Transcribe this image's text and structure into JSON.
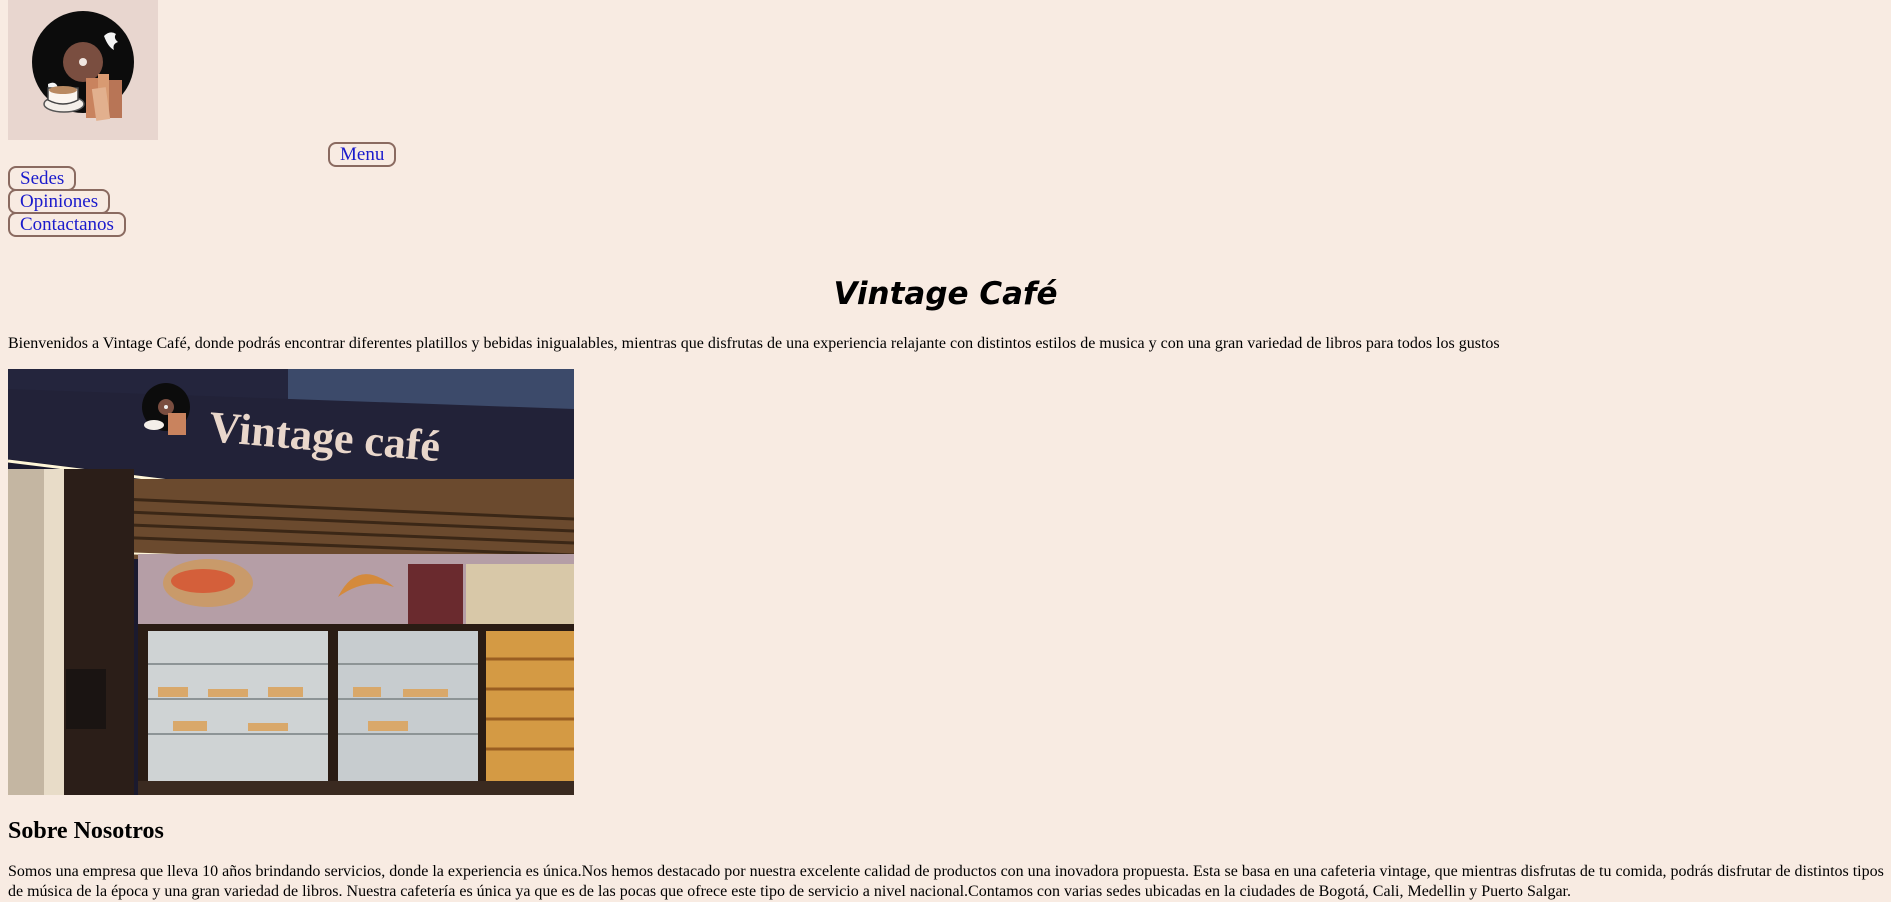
{
  "brand": {
    "logo_icon": "vinyl-coffee-books-logo"
  },
  "nav": {
    "menu": "Menu",
    "sedes": "Sedes",
    "opiniones": "Opiniones",
    "contactanos": "Contactanos"
  },
  "hero": {
    "title": "Vintage Café",
    "intro": "Bienvenidos a Vintage Café, donde podrás encontrar diferentes platillos y bebidas inigualables, mientras que disfrutas de una experiencia relajante con distintos estilos de musica y con una gran variedad de libros para todos los gustos"
  },
  "storefront": {
    "sign_text": "Vintage café"
  },
  "about": {
    "title": "Sobre Nosotros",
    "text": "Somos una empresa que lleva 10 años brindando servicios, donde la experiencia es única.Nos hemos destacado por nuestra excelente calidad de productos con una inovadora propuesta. Esta se basa en una cafeteria vintage, que mientras disfrutas de tu comida, podrás disfrutar de distintos tipos de música de la época y una gran variedad de libros. Nuestra cafetería es única ya que es de las pocas que ofrece este tipo de servicio a nivel nacional.Contamos con varias sedes ubicadas en la ciudades de Bogotá, Cali, Medellin y Puerto Salgar."
  },
  "colors": {
    "background": "#f8ebe2",
    "button_border": "#8a6a60",
    "link_text": "#1a1acc"
  }
}
